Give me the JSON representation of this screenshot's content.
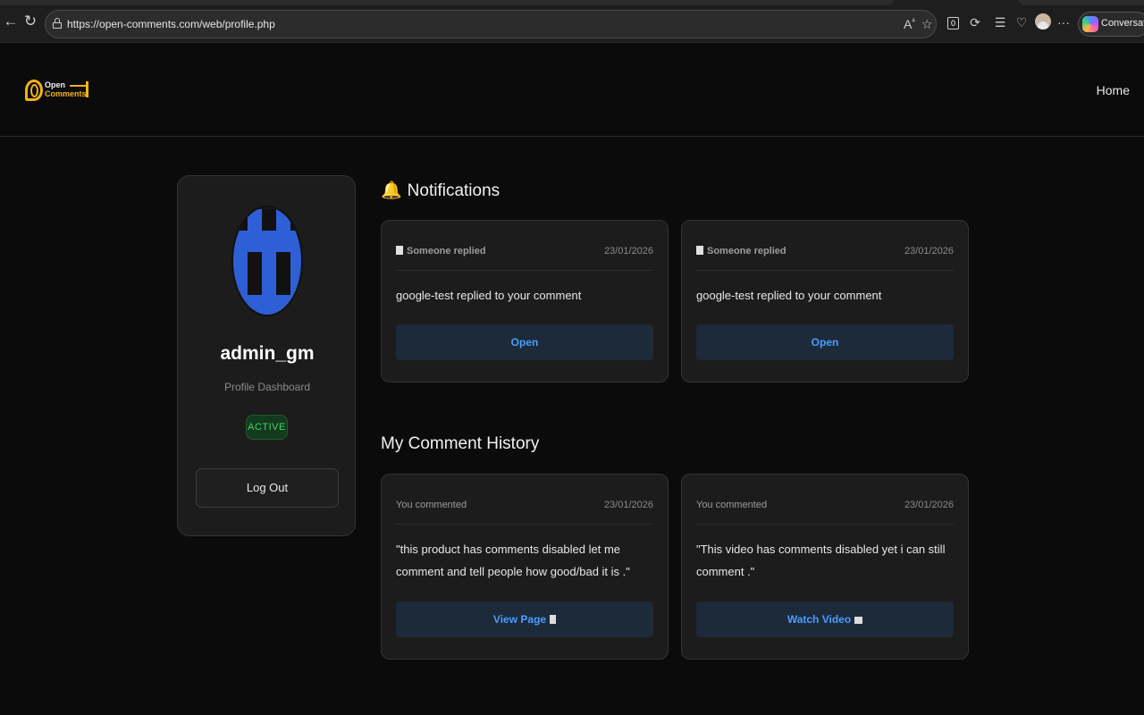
{
  "browser": {
    "url": "https://open-comments.com/web/profile.php",
    "copilot_label": "Conversation",
    "extension_count": "0"
  },
  "site": {
    "logo_top": "Open",
    "logo_bottom": "Comments",
    "home_link": "Home"
  },
  "profile": {
    "username": "admin_gm",
    "subtitle": "Profile Dashboard",
    "status": "ACTIVE",
    "logout_label": "Log Out"
  },
  "notifications": {
    "title": "Notifications",
    "items": [
      {
        "type": "Someone replied",
        "date": "23/01/2026",
        "text": "google-test replied to your comment",
        "button": "Open"
      },
      {
        "type": "Someone replied",
        "date": "23/01/2026",
        "text": "google-test replied to your comment",
        "button": "Open"
      }
    ]
  },
  "history": {
    "title": "My Comment History",
    "items": [
      {
        "type": "You commented",
        "date": "23/01/2026",
        "text": "\"this product has comments disabled let me comment and tell people how good/bad it is .\"",
        "button": "View Page"
      },
      {
        "type": "You commented",
        "date": "23/01/2026",
        "text": "\"This video has comments disabled yet i can still comment .\"",
        "button": "Watch Video"
      }
    ]
  },
  "colors": {
    "accent": "#f2b21a",
    "link_blue": "#4a9dff",
    "active_green": "#43d268",
    "avatar_blue": "#2f5fd6"
  }
}
